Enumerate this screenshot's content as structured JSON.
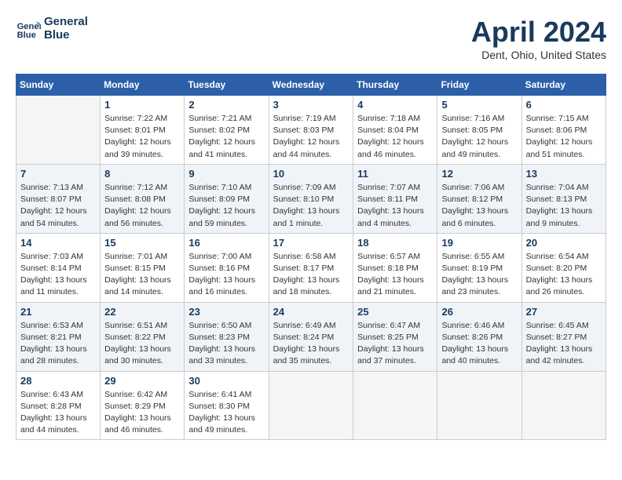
{
  "header": {
    "logo_line1": "General",
    "logo_line2": "Blue",
    "title": "April 2024",
    "subtitle": "Dent, Ohio, United States"
  },
  "weekdays": [
    "Sunday",
    "Monday",
    "Tuesday",
    "Wednesday",
    "Thursday",
    "Friday",
    "Saturday"
  ],
  "weeks": [
    [
      {
        "day": "",
        "info": ""
      },
      {
        "day": "1",
        "info": "Sunrise: 7:22 AM\nSunset: 8:01 PM\nDaylight: 12 hours\nand 39 minutes."
      },
      {
        "day": "2",
        "info": "Sunrise: 7:21 AM\nSunset: 8:02 PM\nDaylight: 12 hours\nand 41 minutes."
      },
      {
        "day": "3",
        "info": "Sunrise: 7:19 AM\nSunset: 8:03 PM\nDaylight: 12 hours\nand 44 minutes."
      },
      {
        "day": "4",
        "info": "Sunrise: 7:18 AM\nSunset: 8:04 PM\nDaylight: 12 hours\nand 46 minutes."
      },
      {
        "day": "5",
        "info": "Sunrise: 7:16 AM\nSunset: 8:05 PM\nDaylight: 12 hours\nand 49 minutes."
      },
      {
        "day": "6",
        "info": "Sunrise: 7:15 AM\nSunset: 8:06 PM\nDaylight: 12 hours\nand 51 minutes."
      }
    ],
    [
      {
        "day": "7",
        "info": "Sunrise: 7:13 AM\nSunset: 8:07 PM\nDaylight: 12 hours\nand 54 minutes."
      },
      {
        "day": "8",
        "info": "Sunrise: 7:12 AM\nSunset: 8:08 PM\nDaylight: 12 hours\nand 56 minutes."
      },
      {
        "day": "9",
        "info": "Sunrise: 7:10 AM\nSunset: 8:09 PM\nDaylight: 12 hours\nand 59 minutes."
      },
      {
        "day": "10",
        "info": "Sunrise: 7:09 AM\nSunset: 8:10 PM\nDaylight: 13 hours\nand 1 minute."
      },
      {
        "day": "11",
        "info": "Sunrise: 7:07 AM\nSunset: 8:11 PM\nDaylight: 13 hours\nand 4 minutes."
      },
      {
        "day": "12",
        "info": "Sunrise: 7:06 AM\nSunset: 8:12 PM\nDaylight: 13 hours\nand 6 minutes."
      },
      {
        "day": "13",
        "info": "Sunrise: 7:04 AM\nSunset: 8:13 PM\nDaylight: 13 hours\nand 9 minutes."
      }
    ],
    [
      {
        "day": "14",
        "info": "Sunrise: 7:03 AM\nSunset: 8:14 PM\nDaylight: 13 hours\nand 11 minutes."
      },
      {
        "day": "15",
        "info": "Sunrise: 7:01 AM\nSunset: 8:15 PM\nDaylight: 13 hours\nand 14 minutes."
      },
      {
        "day": "16",
        "info": "Sunrise: 7:00 AM\nSunset: 8:16 PM\nDaylight: 13 hours\nand 16 minutes."
      },
      {
        "day": "17",
        "info": "Sunrise: 6:58 AM\nSunset: 8:17 PM\nDaylight: 13 hours\nand 18 minutes."
      },
      {
        "day": "18",
        "info": "Sunrise: 6:57 AM\nSunset: 8:18 PM\nDaylight: 13 hours\nand 21 minutes."
      },
      {
        "day": "19",
        "info": "Sunrise: 6:55 AM\nSunset: 8:19 PM\nDaylight: 13 hours\nand 23 minutes."
      },
      {
        "day": "20",
        "info": "Sunrise: 6:54 AM\nSunset: 8:20 PM\nDaylight: 13 hours\nand 26 minutes."
      }
    ],
    [
      {
        "day": "21",
        "info": "Sunrise: 6:53 AM\nSunset: 8:21 PM\nDaylight: 13 hours\nand 28 minutes."
      },
      {
        "day": "22",
        "info": "Sunrise: 6:51 AM\nSunset: 8:22 PM\nDaylight: 13 hours\nand 30 minutes."
      },
      {
        "day": "23",
        "info": "Sunrise: 6:50 AM\nSunset: 8:23 PM\nDaylight: 13 hours\nand 33 minutes."
      },
      {
        "day": "24",
        "info": "Sunrise: 6:49 AM\nSunset: 8:24 PM\nDaylight: 13 hours\nand 35 minutes."
      },
      {
        "day": "25",
        "info": "Sunrise: 6:47 AM\nSunset: 8:25 PM\nDaylight: 13 hours\nand 37 minutes."
      },
      {
        "day": "26",
        "info": "Sunrise: 6:46 AM\nSunset: 8:26 PM\nDaylight: 13 hours\nand 40 minutes."
      },
      {
        "day": "27",
        "info": "Sunrise: 6:45 AM\nSunset: 8:27 PM\nDaylight: 13 hours\nand 42 minutes."
      }
    ],
    [
      {
        "day": "28",
        "info": "Sunrise: 6:43 AM\nSunset: 8:28 PM\nDaylight: 13 hours\nand 44 minutes."
      },
      {
        "day": "29",
        "info": "Sunrise: 6:42 AM\nSunset: 8:29 PM\nDaylight: 13 hours\nand 46 minutes."
      },
      {
        "day": "30",
        "info": "Sunrise: 6:41 AM\nSunset: 8:30 PM\nDaylight: 13 hours\nand 49 minutes."
      },
      {
        "day": "",
        "info": ""
      },
      {
        "day": "",
        "info": ""
      },
      {
        "day": "",
        "info": ""
      },
      {
        "day": "",
        "info": ""
      }
    ]
  ]
}
